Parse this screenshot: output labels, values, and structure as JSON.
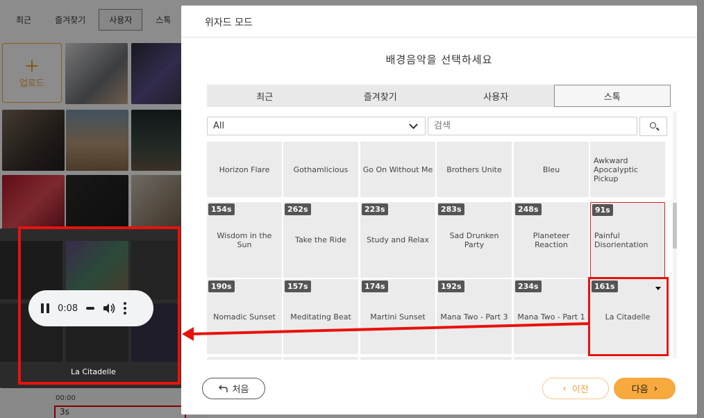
{
  "background": {
    "tabs": [
      {
        "label": "최근",
        "active": false
      },
      {
        "label": "즐겨찾기",
        "active": false
      },
      {
        "label": "사용자",
        "active": true
      },
      {
        "label": "스톡",
        "active": false
      }
    ],
    "upload_label": "업로드",
    "timeline_time": "00:00",
    "clip_label": "3s"
  },
  "preview": {
    "time": "0:08",
    "title": "La Citadelle",
    "state": "playing"
  },
  "modal": {
    "title": "위자드 모드",
    "subtitle": "배경음악을 선택하세요",
    "tabs": [
      {
        "label": "최근",
        "active": false
      },
      {
        "label": "즐겨찾기",
        "active": false
      },
      {
        "label": "사용자",
        "active": false
      },
      {
        "label": "스톡",
        "active": true
      }
    ],
    "filter": {
      "selected": "All"
    },
    "search": {
      "placeholder": "검색"
    },
    "tracks": [
      [
        {
          "title": "Horizon Flare",
          "duration": ""
        },
        {
          "title": "Gothamlicious",
          "duration": ""
        },
        {
          "title": "Go On Without Me",
          "duration": ""
        },
        {
          "title": "Brothers Unite",
          "duration": ""
        },
        {
          "title": "Bleu",
          "duration": ""
        },
        {
          "title": "Awkward Apocalyptic Pickup",
          "duration": ""
        }
      ],
      [
        {
          "title": "Wisdom in the Sun",
          "duration": "154s"
        },
        {
          "title": "Take the Ride",
          "duration": "262s"
        },
        {
          "title": "Study and Relax",
          "duration": "223s"
        },
        {
          "title": "Sad Drunken Party",
          "duration": "283s"
        },
        {
          "title": "Planeteer Reaction",
          "duration": "248s"
        },
        {
          "title": "Painful Disorientation",
          "duration": "91s"
        }
      ],
      [
        {
          "title": "Nomadic Sunset",
          "duration": "190s"
        },
        {
          "title": "Meditating Beat",
          "duration": "157s"
        },
        {
          "title": "Martini Sunset",
          "duration": "174s"
        },
        {
          "title": "Mana Two - Part 3",
          "duration": "192s"
        },
        {
          "title": "Mana Two - Part 1",
          "duration": "234s"
        },
        {
          "title": "La Citadelle",
          "duration": "161s"
        }
      ]
    ],
    "buttons": {
      "first": "처음",
      "prev": "이전",
      "next": "다음"
    }
  },
  "colors": {
    "accent": "#f7a93d",
    "highlight": "#e8120c"
  }
}
